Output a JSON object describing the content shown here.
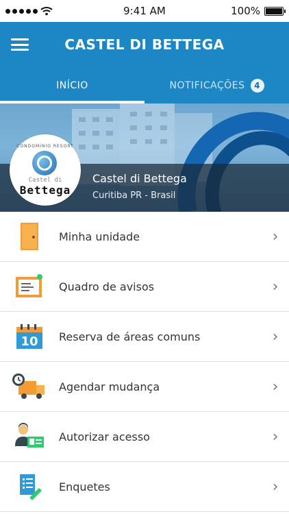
{
  "status": {
    "time": "9:41 AM",
    "battery": "100%"
  },
  "header": {
    "title": "CASTEL DI BETTEGA"
  },
  "tabs": [
    {
      "label": "INÍCIO",
      "active": true
    },
    {
      "label": "NOTIFICAÇÕES",
      "active": false,
      "badge": "4"
    }
  ],
  "hero": {
    "name": "Castel di Bettega",
    "location": "Curitiba PR - Brasil",
    "logo": {
      "arc_text": "CONDOMÍNIO RESORT",
      "small_text": "Castel di",
      "big_text": "Bettega"
    }
  },
  "menu": [
    {
      "label": "Minha unidade",
      "icon": "door-icon"
    },
    {
      "label": "Quadro de avisos",
      "icon": "noticeboard-icon"
    },
    {
      "label": "Reserva de áreas comuns",
      "icon": "calendar-icon"
    },
    {
      "label": "Agendar mudança",
      "icon": "moving-truck-icon"
    },
    {
      "label": "Autorizar acesso",
      "icon": "person-id-icon"
    },
    {
      "label": "Enquetes",
      "icon": "survey-icon"
    }
  ],
  "calendar_day": "10",
  "colors": {
    "primary": "#1d87c5",
    "accent_orange": "#f39c34",
    "dark_blue": "#1565b0"
  }
}
